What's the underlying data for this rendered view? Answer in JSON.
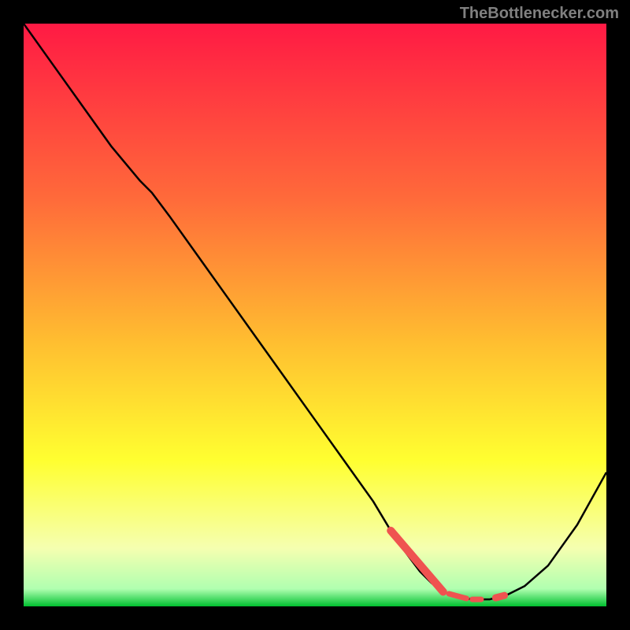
{
  "watermark": "TheBottlenecker.com",
  "chart_data": {
    "type": "line",
    "title": "",
    "xlabel": "",
    "ylabel": "",
    "xlim": [
      0,
      100
    ],
    "ylim": [
      0,
      100
    ],
    "grid": false,
    "background": "gradient",
    "gradient_stops": [
      {
        "pct": 0,
        "color": "#ff1a44"
      },
      {
        "pct": 30,
        "color": "#ff6a3a"
      },
      {
        "pct": 55,
        "color": "#ffbf30"
      },
      {
        "pct": 75,
        "color": "#ffff30"
      },
      {
        "pct": 90,
        "color": "#f5ffb0"
      },
      {
        "pct": 97,
        "color": "#b0ffb0"
      },
      {
        "pct": 100,
        "color": "#00c030"
      }
    ],
    "series": [
      {
        "name": "curve",
        "color": "#000000",
        "x": [
          0,
          5,
          10,
          15,
          20,
          22,
          25,
          30,
          35,
          40,
          45,
          50,
          55,
          60,
          63,
          65,
          68,
          70,
          72,
          75,
          77,
          80,
          83,
          86,
          90,
          95,
          100
        ],
        "y": [
          100,
          93,
          86,
          79,
          73,
          71,
          67,
          60,
          53,
          46,
          39,
          32,
          25,
          18,
          13,
          10,
          6,
          4,
          2.5,
          1.5,
          1.2,
          1.2,
          2,
          3.5,
          7,
          14,
          23
        ]
      }
    ],
    "highlights": [
      {
        "name": "highlight-segment",
        "x": [
          63,
          72
        ],
        "y_approx": 3.0,
        "color": "#ef5350",
        "thickness": 10
      },
      {
        "name": "highlight-dash-1",
        "x": [
          73,
          76
        ],
        "y_approx": 2.3,
        "color": "#ef5350",
        "thickness": 7
      },
      {
        "name": "highlight-dash-2",
        "x": [
          77,
          78.5
        ],
        "y_approx": 2.3,
        "color": "#ef5350",
        "thickness": 7
      },
      {
        "name": "highlight-dot",
        "x": [
          81,
          82.5
        ],
        "y_approx": 3.2,
        "color": "#ef5350",
        "thickness": 9
      }
    ]
  }
}
